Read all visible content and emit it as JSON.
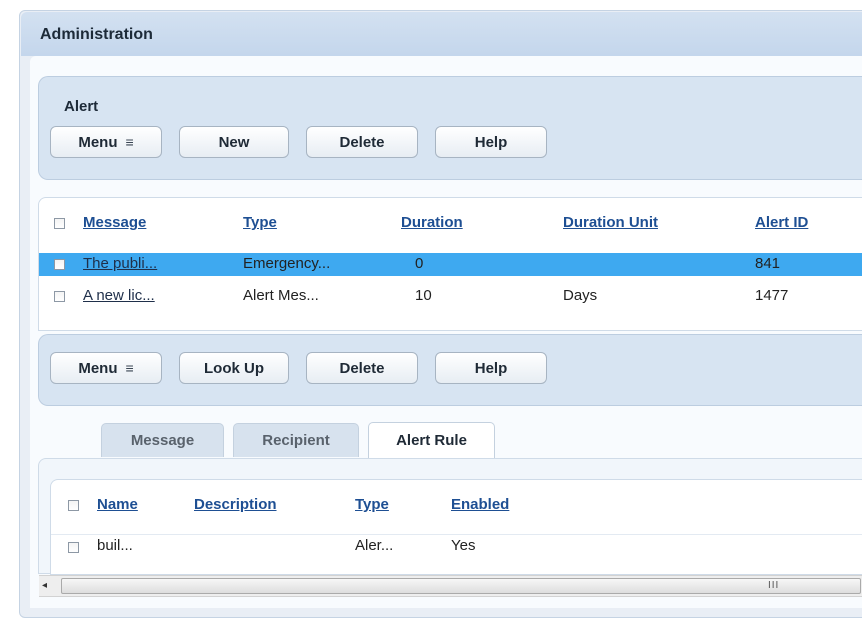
{
  "window": {
    "title": "Administration"
  },
  "alert_panel": {
    "title": "Alert",
    "toolbar": {
      "menu": "Menu",
      "new": "New",
      "delete": "Delete",
      "help": "Help"
    }
  },
  "alert_grid": {
    "headers": [
      "Message",
      "Type",
      "Duration",
      "Duration Unit",
      "Alert ID"
    ],
    "rows": [
      {
        "message": "The publi...",
        "type": "Emergency...",
        "duration": "0",
        "duration_unit": "",
        "alert_id": "841",
        "selected": true
      },
      {
        "message": "A new lic...",
        "type": "Alert Mes...",
        "duration": "10",
        "duration_unit": "Days",
        "alert_id": "1477",
        "selected": false
      }
    ]
  },
  "detail_toolbar": {
    "menu": "Menu",
    "lookup": "Look Up",
    "delete": "Delete",
    "help": "Help"
  },
  "tabs": [
    {
      "label": "Message",
      "active": false
    },
    {
      "label": "Recipient",
      "active": false
    },
    {
      "label": "Alert Rule",
      "active": true
    }
  ],
  "rule_grid": {
    "headers": [
      "Name",
      "Description",
      "Type",
      "Enabled"
    ],
    "rows": [
      {
        "name": "buil...",
        "description": "",
        "type": "Aler...",
        "enabled": "Yes"
      }
    ]
  },
  "scrollbar": {
    "left_arrow": "◂",
    "grip": "III"
  },
  "icons": {
    "menu": "≡",
    "scroll_left": "◂"
  },
  "colors": {
    "selected_row": "#3ea9f0",
    "header_link": "#1e4f93",
    "panel": "#d7e4f2"
  }
}
